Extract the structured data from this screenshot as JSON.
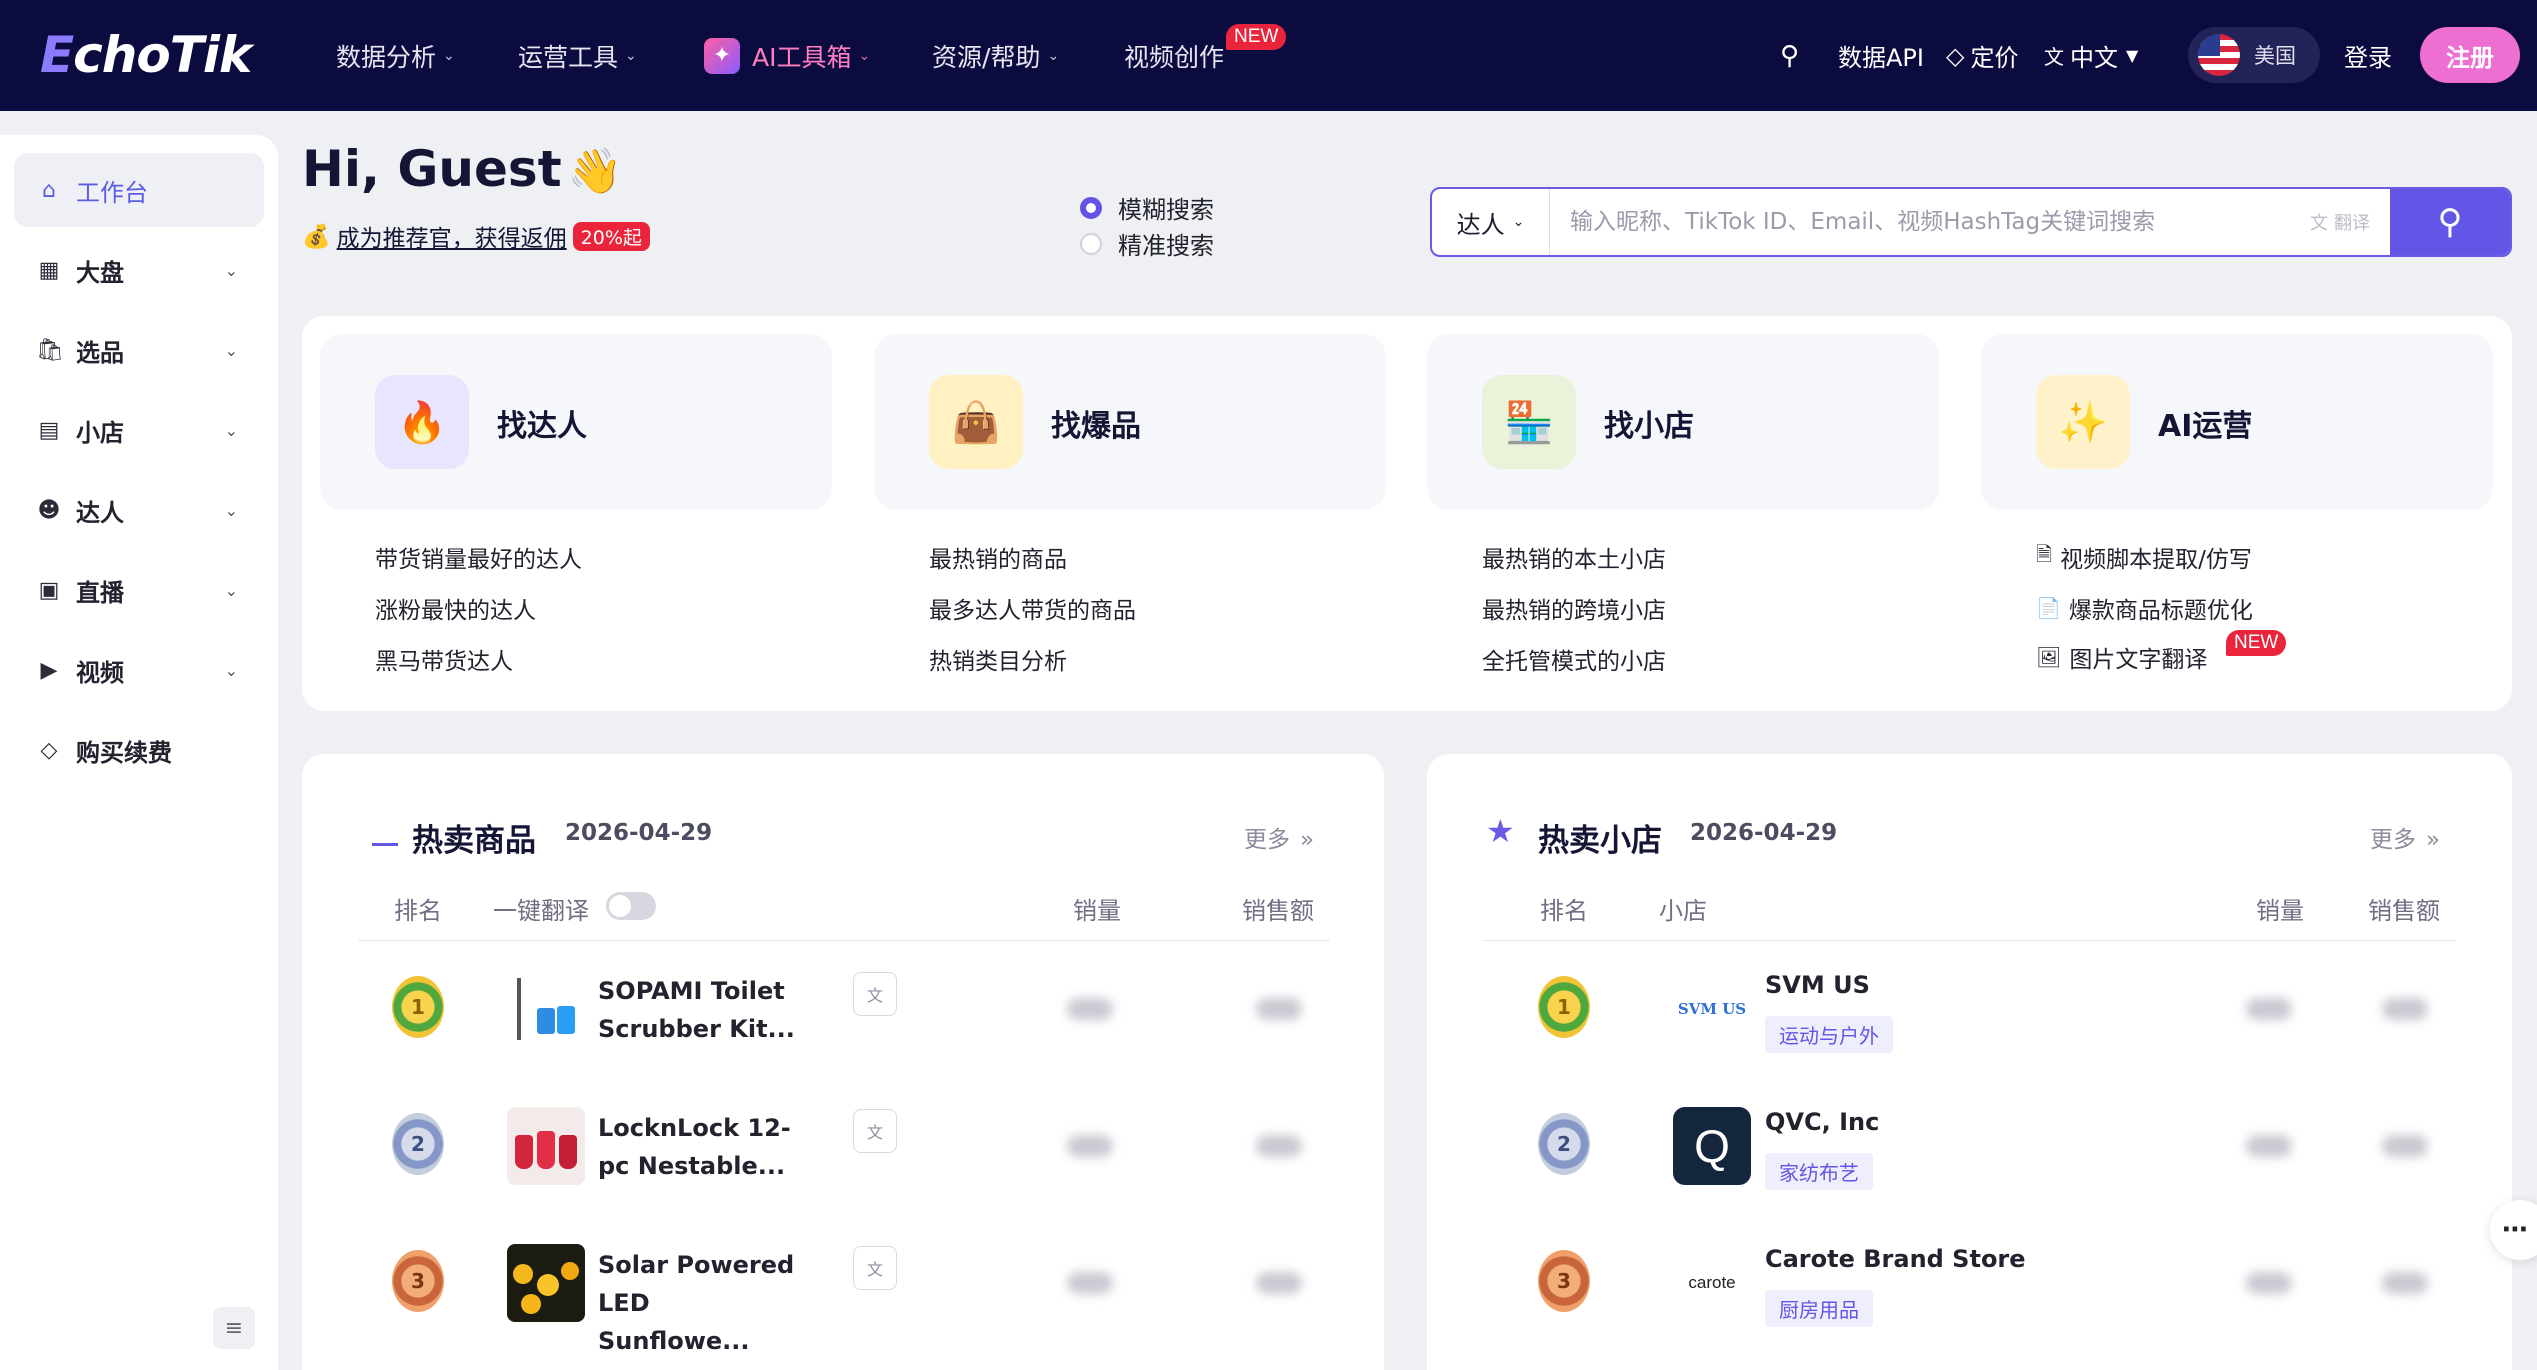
{
  "header": {
    "logo": "EchoTik",
    "nav": [
      {
        "label": "数据分析"
      },
      {
        "label": "运营工具"
      },
      {
        "label": "AI工具箱"
      },
      {
        "label": "资源/帮助"
      },
      {
        "label": "视频创作",
        "badge": "NEW"
      }
    ],
    "api_label": "数据API",
    "pricing_label": "定价",
    "language_label": "中文",
    "region_label": "美国",
    "login_label": "登录",
    "signup_label": "注册",
    "colors": {
      "bar_bg": "#0c0b3f",
      "accent": "#6355e6",
      "signup": "#ec6fd1",
      "badge": "#e9243b"
    }
  },
  "sidebar": {
    "items": [
      {
        "label": "工作台",
        "icon": "home-icon",
        "active": true
      },
      {
        "label": "大盘",
        "icon": "grid-icon"
      },
      {
        "label": "选品",
        "icon": "bag-icon"
      },
      {
        "label": "小店",
        "icon": "store-icon"
      },
      {
        "label": "达人",
        "icon": "user-icon"
      },
      {
        "label": "直播",
        "icon": "live-icon"
      },
      {
        "label": "视频",
        "icon": "video-icon"
      },
      {
        "label": "购买续费",
        "icon": "diamond-icon"
      }
    ]
  },
  "greeting": {
    "title": "Hi, Guest",
    "referral_text": "成为推荐官，获得返佣",
    "referral_badge": "20%起"
  },
  "search": {
    "mode_fuzzy": "模糊搜索",
    "mode_exact": "精准搜索",
    "selected_mode": "模糊搜索",
    "type_label": "达人",
    "placeholder": "输入昵称、TikTok ID、Email、视频HashTag关键词搜索",
    "translate_label": "翻译"
  },
  "quick_cards": [
    {
      "title": "找达人",
      "links": [
        "带货销量最好的达人",
        "涨粉最快的达人",
        "黑马带货达人"
      ]
    },
    {
      "title": "找爆品",
      "links": [
        "最热销的商品",
        "最多达人带货的商品",
        "热销类目分析"
      ]
    },
    {
      "title": "找小店",
      "links": [
        "最热销的本土小店",
        "最热销的跨境小店",
        "全托管模式的小店"
      ]
    },
    {
      "title": "AI运营",
      "links": [
        "视频脚本提取/仿写",
        "爆款商品标题优化",
        "图片文字翻译"
      ],
      "new_badge": "NEW"
    }
  ],
  "hot_products": {
    "title": "热卖商品",
    "date": "2026-04-29",
    "more_label": "更多",
    "columns": {
      "rank": "排名",
      "translate": "一键翻译",
      "sales": "销量",
      "revenue": "销售额"
    },
    "rows": [
      {
        "rank": "1",
        "name_line1": "SOPAMI Toilet",
        "name_line2": "Scrubber Kit..."
      },
      {
        "rank": "2",
        "name_line1": "LocknLock 12-",
        "name_line2": "pc Nestable..."
      },
      {
        "rank": "3",
        "name_line1": "Solar Powered",
        "name_line2": "LED Sunflowe..."
      }
    ]
  },
  "hot_shops": {
    "title": "热卖小店",
    "date": "2026-04-29",
    "more_label": "更多",
    "columns": {
      "rank": "排名",
      "shop": "小店",
      "sales": "销量",
      "revenue": "销售额"
    },
    "rows": [
      {
        "rank": "1",
        "name": "SVM US",
        "category": "运动与户外",
        "logo_text": "SVM US"
      },
      {
        "rank": "2",
        "name": "QVC, Inc",
        "category": "家纺布艺",
        "logo_text": "Q"
      },
      {
        "rank": "3",
        "name": "Carote Brand Store",
        "category": "厨房用品",
        "logo_text": "carote"
      }
    ]
  }
}
